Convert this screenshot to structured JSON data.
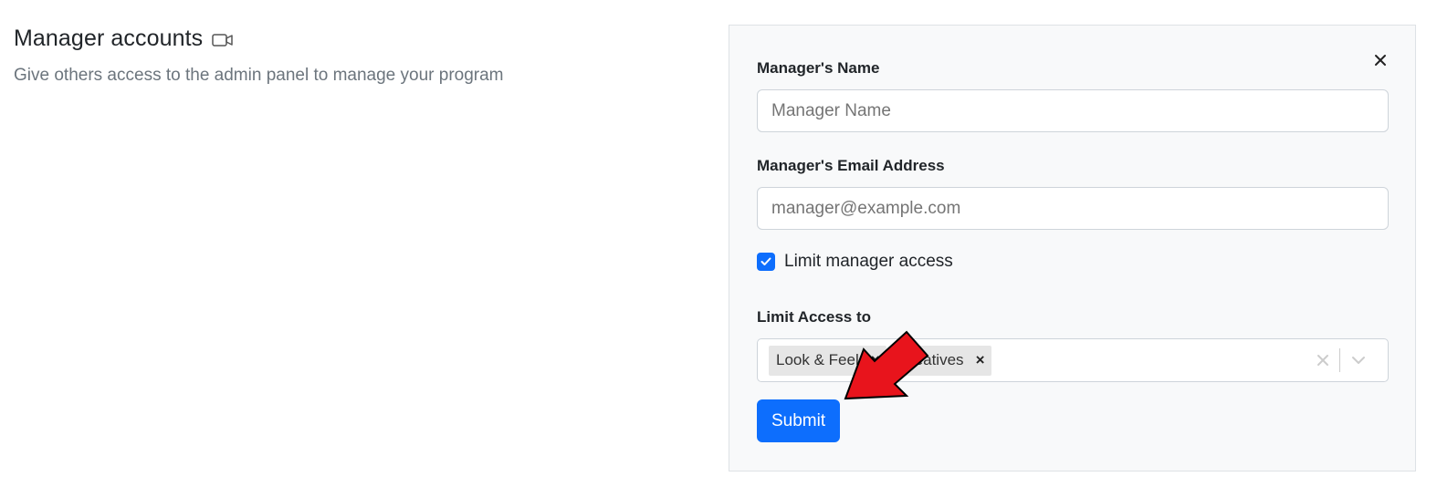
{
  "header": {
    "title": "Manager accounts",
    "title_icon": "video-camera-icon",
    "subtitle": "Give others access to the admin panel to manage your program"
  },
  "panel": {
    "close_icon": "close-icon",
    "name_field": {
      "label": "Manager's Name",
      "placeholder": "Manager Name",
      "value": ""
    },
    "email_field": {
      "label": "Manager's Email Address",
      "placeholder": "manager@example.com",
      "value": ""
    },
    "limit_checkbox": {
      "label": "Limit manager access",
      "checked": true
    },
    "limit_access": {
      "label": "Limit Access to",
      "selected": [
        {
          "label": "Look & Feel"
        },
        {
          "label": "Creatives"
        }
      ]
    },
    "submit_label": "Submit"
  },
  "annotation": {
    "arrow_color": "#e8141c",
    "points_to": "submit-button"
  },
  "colors": {
    "primary": "#0d6efd",
    "panel_bg": "#f8f9fa",
    "muted_text": "#6c757d"
  }
}
